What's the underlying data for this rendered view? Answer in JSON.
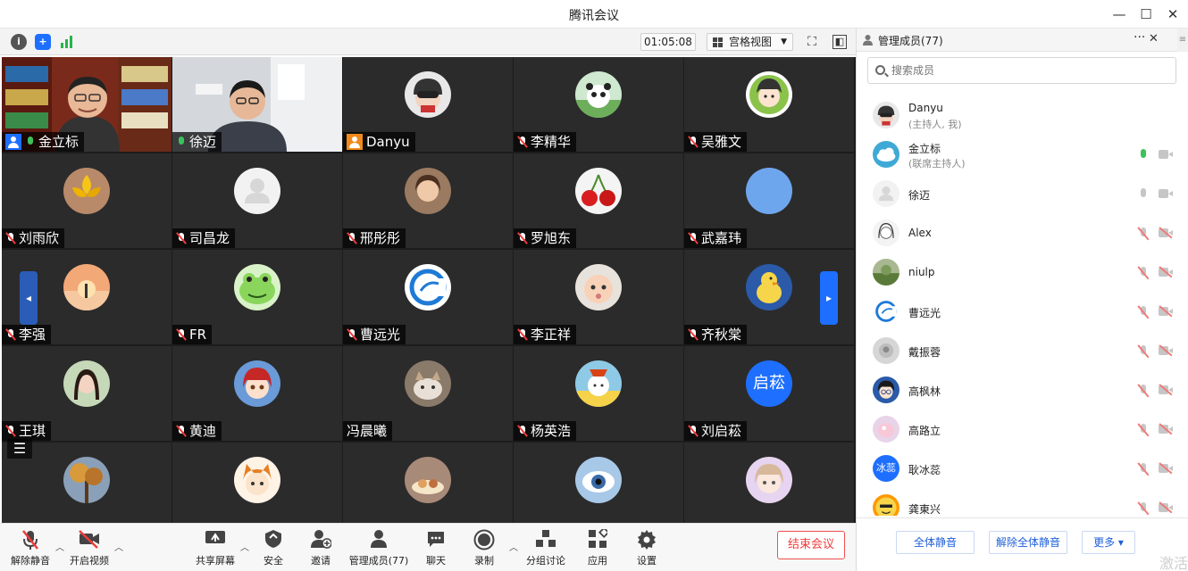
{
  "window": {
    "title": "腾讯会议",
    "minimize": "—",
    "maximize": "☐",
    "close": "✕"
  },
  "topbar": {
    "timer": "01:05:08",
    "view_label": "宫格视图",
    "view_caret": "▼",
    "fullscreen_icon": "⛶",
    "sidebar_icon": "◧"
  },
  "tiles": [
    {
      "name": "金立标",
      "mic": "on",
      "host": "blue",
      "video": "bookshelf"
    },
    {
      "name": "徐迈",
      "mic": "on",
      "video": "office"
    },
    {
      "name": "Danyu",
      "host": "orange",
      "avatar": "helmet"
    },
    {
      "name": "李精华",
      "mic": "off",
      "avatar": "panda"
    },
    {
      "name": "吴雅文",
      "mic": "off",
      "avatar": "cartoon-girl"
    },
    {
      "name": "刘雨欣",
      "mic": "off",
      "avatar": "flower"
    },
    {
      "name": "司昌龙",
      "mic": "off",
      "avatar": "default"
    },
    {
      "name": "邢彤彤",
      "mic": "off",
      "avatar": "portrait"
    },
    {
      "name": "罗旭东",
      "mic": "off",
      "avatar": "cherries"
    },
    {
      "name": "武嘉玮",
      "mic": "off",
      "avatar": "blue-circle"
    },
    {
      "name": "李强",
      "mic": "off",
      "avatar": "sunset"
    },
    {
      "name": "FR",
      "mic": "off",
      "avatar": "frog"
    },
    {
      "name": "曹远光",
      "mic": "off",
      "avatar": "logo-c"
    },
    {
      "name": "李正祥",
      "mic": "off",
      "avatar": "baby"
    },
    {
      "name": "齐秋棠",
      "mic": "off",
      "avatar": "duck"
    },
    {
      "name": "王琪",
      "mic": "off",
      "avatar": "girl"
    },
    {
      "name": "黄迪",
      "mic": "off",
      "avatar": "anime"
    },
    {
      "name": "冯晨曦",
      "avatar": "cat"
    },
    {
      "name": "杨英浩",
      "mic": "off",
      "avatar": "cartoon-cat"
    },
    {
      "name": "刘启菘",
      "mic": "off",
      "avatar_text": "启菘"
    },
    {
      "name": "",
      "avatar": "autumn"
    },
    {
      "name": "",
      "avatar": "fox-girl"
    },
    {
      "name": "",
      "avatar": "food"
    },
    {
      "name": "",
      "avatar": "eye"
    },
    {
      "name": "",
      "avatar": "doll"
    }
  ],
  "bottombar": {
    "unmute": "解除静音",
    "start_video": "开启视频",
    "share": "共享屏幕",
    "security": "安全",
    "invite": "邀请",
    "manage": "管理成员(77)",
    "chat": "聊天",
    "record": "录制",
    "breakout": "分组讨论",
    "apps": "应用",
    "settings": "设置",
    "end": "结束会议"
  },
  "panel": {
    "title": "管理成员(77)",
    "more": "···",
    "close": "✕",
    "scroll": "≡",
    "search_placeholder": "搜索成员",
    "members": [
      {
        "name": "Danyu",
        "sub": "(主持人, 我)",
        "avatar": "helmet"
      },
      {
        "name": "金立标",
        "sub": "(联席主持人)",
        "avatar": "cloud",
        "mic": "on",
        "cam": "normal"
      },
      {
        "name": "徐迈",
        "avatar": "default",
        "mic": "normal",
        "cam": "normal"
      },
      {
        "name": "Alex",
        "avatar": "girl-sketch",
        "mic": "off",
        "cam": "off"
      },
      {
        "name": "niulp",
        "avatar": "landscape",
        "mic": "off",
        "cam": "off"
      },
      {
        "name": "曹远光",
        "avatar": "logo-c",
        "mic": "off",
        "cam": "off"
      },
      {
        "name": "戴振蓉",
        "avatar": "gray-art",
        "mic": "off",
        "cam": "off"
      },
      {
        "name": "高枫林",
        "avatar": "conan",
        "mic": "off",
        "cam": "off"
      },
      {
        "name": "高路立",
        "avatar": "pink-art",
        "mic": "off",
        "cam": "off"
      },
      {
        "name": "耿冰蕊",
        "avatar_text": "冰蕊",
        "mic": "off",
        "cam": "off"
      },
      {
        "name": "龚東兴",
        "avatar": "yellow-face",
        "mic": "off",
        "cam": "off"
      }
    ],
    "mute_all": "全体静音",
    "unmute_all": "解除全体静音",
    "more_label": "更多 ▾"
  },
  "watermark": "激活",
  "colors": {
    "accent": "#1e6fff",
    "danger": "#f03c3c",
    "active_speaker": "#3cc25a"
  }
}
